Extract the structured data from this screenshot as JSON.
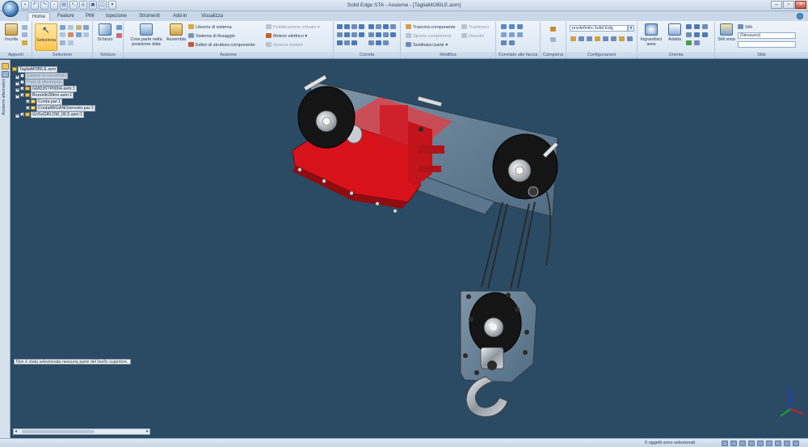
{
  "window": {
    "title": "Solid Edge ST6 - Assieme - [TagliaMOBILE.asm]"
  },
  "tabs": [
    "Home",
    "Feature",
    "PMI",
    "Ispezione",
    "Strumenti",
    "Add-in",
    "Visualizza"
  ],
  "ribbon": {
    "groups": {
      "appunti": "Appunti",
      "selezione": "Selezione",
      "schizzo": "Schizzo",
      "assieme": "Assieme",
      "correla": "Correla",
      "modifica": "Modifica",
      "correlato_faccia": "Correlato alle faccia",
      "campiona": "Campiona",
      "configurazioni": "Configurazioni",
      "orienta": "Orienta",
      "stile": "Stile"
    },
    "buttons": {
      "incolla": "Incolla",
      "seleziona": "Seleziona",
      "schizzo": "Schizzo",
      "crea_parte": "Crea parte nella posizione data",
      "assembla": "Assembla",
      "libreria": "Libreria di sistema",
      "sistema_fissaggio": "Sistema di fissaggio",
      "editor_struttura": "Editor di struttura componente",
      "pubblicazione": "Pubblicazione virtuale",
      "motore": "Motore elettrico",
      "genera_motore": "Genera motore",
      "trascina": "Trascina componente",
      "sposta": "Sposta componenti",
      "sostituisci": "Sostituisci parte",
      "trasferisci": "Trasferisci",
      "dissolvi": "Dissolvi",
      "ingrandisci": "Ingrandisci area",
      "adatta": "Adatta",
      "stili_vista": "Stili vista",
      "stile_label": "Stili",
      "nessuno": "(Nessuno)"
    },
    "config_combo": "predefinito,Solid Edg"
  },
  "left_strip": {
    "label": "Assiemi alternativi"
  },
  "tree": [
    {
      "label": "TagliaMOBILE.asm",
      "type": "root"
    },
    {
      "label": "Sistemi di coordinate",
      "type": "dim"
    },
    {
      "label": "Piani di riferimento",
      "type": "dim"
    },
    {
      "label": "GMD26TP0004.asm:1",
      "type": "asm"
    },
    {
      "label": "Bozzello30ton.asm:1",
      "type": "asm"
    },
    {
      "label": "Corda.par:1",
      "type": "part"
    },
    {
      "label": "CordaARGANOservizio.par:1",
      "type": "part"
    },
    {
      "label": "GriSoGRLOM_06.5.asm:1",
      "type": "asm"
    }
  ],
  "message": "Non è stata selezionata nessuna parte del livello superiore.",
  "status": {
    "text": "0 oggetti sono selezionati"
  },
  "colors": {
    "viewport_bg": "#2b4a64",
    "frame_red": "#d8121b",
    "housing_glass": "#9eb6c8",
    "sheave": "#141414"
  }
}
